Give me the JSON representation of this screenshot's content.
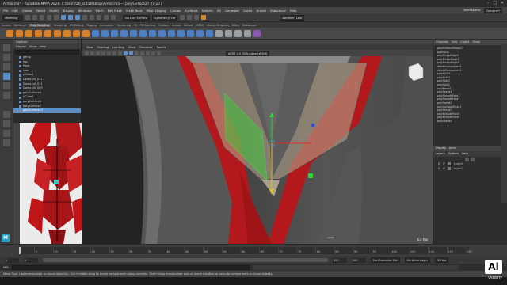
{
  "window": {
    "title": "Armor.ma* - Autodesk MAYA 2024: C:\\Users\\ab_sr2\\Desktop\\Armor.ma  ---  polySurface27.f[0:27]",
    "controls": [
      "–",
      "□",
      "✕"
    ]
  },
  "menubar": {
    "items": [
      "File",
      "Edit",
      "Create",
      "Select",
      "Modify",
      "Display",
      "Windows",
      "Mesh",
      "Edit Mesh",
      "Mesh Tools",
      "Mesh Display",
      "Curves",
      "Surfaces",
      "Deform",
      "UV",
      "Generate",
      "Cache",
      "Arnold",
      "Substance",
      "Help"
    ],
    "workspace_label": "Workspace:",
    "workspace_value": "General*"
  },
  "statusline": {
    "mode": "Modeling",
    "live_surface": "No Live Surface",
    "symmetry": "Symmetry: Off",
    "login": "Abraham Leal"
  },
  "shelf": {
    "tabs": [
      "Curves",
      "Surfaces",
      "Poly Modeling",
      "Sculpting",
      "UV Editing",
      "Rigging",
      "Animation",
      "Rendering",
      "FX",
      "FX Caching",
      "Custom",
      "Arnold",
      "Bifrost",
      "MASH",
      "Motion Graphics",
      "XGen",
      "Substance"
    ],
    "active_tab": "Poly Modeling"
  },
  "outliner": {
    "title": "Outliner",
    "menu": [
      "Display",
      "Show",
      "Help"
    ],
    "items": [
      "persp",
      "top",
      "front",
      "side",
      "pCube1",
      "Dama_s0_011",
      "Dama_s0_011",
      "Dama_s0_009",
      "polySurface4",
      "pCube2",
      "polySurface6",
      "polySurface7",
      "polySurface27"
    ],
    "selected_index": 12
  },
  "viewport": {
    "menu": [
      "View",
      "Shading",
      "Lighting",
      "Show",
      "Renderer",
      "Panels"
    ],
    "colorspace": "ACES 1.0 SDR-video (sRGB)",
    "camera_label": "persp",
    "fps": "4.2 fps"
  },
  "channelbox": {
    "tabs": [
      "Channels",
      "Edit",
      "Object",
      "Show"
    ],
    "items": [
      "polySurfaceShape27",
      "pgroup27",
      "polyBridgeEdge3",
      "polyBridgeEdge2",
      "polyBridgeEdge1",
      "deleteComponent2",
      "deleteComponent1",
      "polySplit4",
      "polySplit3",
      "polySplit2",
      "polySplit1",
      "polyBevel1",
      "polyTweak1",
      "polySmoothFace1",
      "polySmoothFace2",
      "polyTweak2",
      "polyCollapseEdge1",
      "polyTweak3",
      "polyExtrudeFace1",
      "polyExtrudeFace2",
      "polyTweak4"
    ]
  },
  "layers": {
    "tabs": [
      "Display",
      "Anim"
    ],
    "menu": [
      "Layers",
      "Options",
      "Help"
    ],
    "rows": [
      {
        "v": "V",
        "p": "P",
        "name": "layer2"
      },
      {
        "v": "V",
        "p": "P",
        "name": "layer1"
      }
    ]
  },
  "timeline": {
    "ticks": [
      "5",
      "10",
      "15",
      "20",
      "25",
      "30",
      "35",
      "40",
      "45",
      "50",
      "55",
      "60",
      "65",
      "70",
      "75",
      "80",
      "85",
      "90",
      "95",
      "100",
      "105",
      "110",
      "115",
      "120"
    ],
    "start": "1",
    "end": "120",
    "range_start": "1",
    "range_end": "200",
    "char_set": "No Character Set",
    "anim_layer": "No Anim Layer",
    "fps_setting": "24 fps"
  },
  "cmdline": {
    "label": "MEL"
  },
  "helpline": {
    "text": "Move Tool: Use manipulator to move object(s). Ctrl+middle-drag to move components along normals. Shift+drag manipulator axis or plane handles to extrude components or clone objects."
  },
  "watermark": {
    "logo": "Al",
    "brand": "Udemy"
  },
  "colors": {
    "accent": "#5b8fc7",
    "armor_red": "#b3191c",
    "selection_green": "#2fd42f"
  }
}
